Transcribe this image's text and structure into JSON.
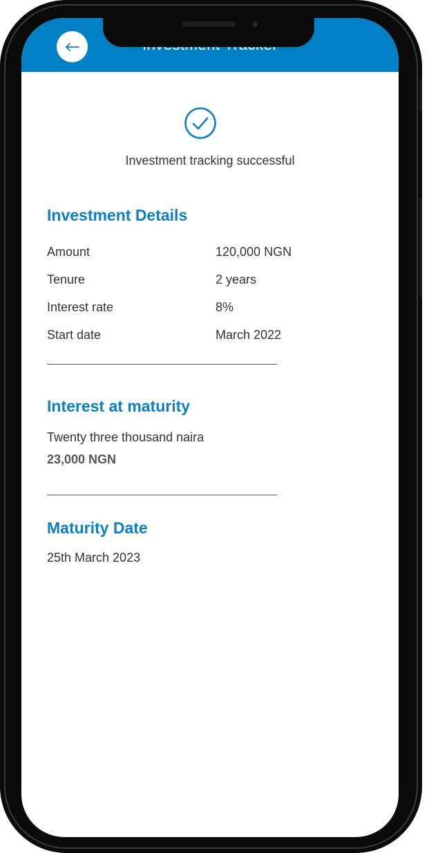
{
  "header": {
    "title": "Investment Tracker",
    "back_icon": "arrow-left-icon",
    "color": "#0280c6"
  },
  "status": {
    "icon": "check-circle-icon",
    "message": "Investment tracking successful"
  },
  "investment_details": {
    "title": "Investment Details",
    "rows": [
      {
        "label": "Amount",
        "value": "120,000 NGN"
      },
      {
        "label": "Tenure",
        "value": "2 years"
      },
      {
        "label": "Interest rate",
        "value": "8%"
      },
      {
        "label": "Start date",
        "value": "March 2022"
      }
    ]
  },
  "interest_at_maturity": {
    "title": "Interest at maturity",
    "words": "Twenty three thousand naira",
    "amount": "23,000 NGN"
  },
  "maturity_date": {
    "title": "Maturity Date",
    "value": "25th March 2023"
  },
  "colors": {
    "accent": "#0b7fc4",
    "text": "#333333"
  }
}
